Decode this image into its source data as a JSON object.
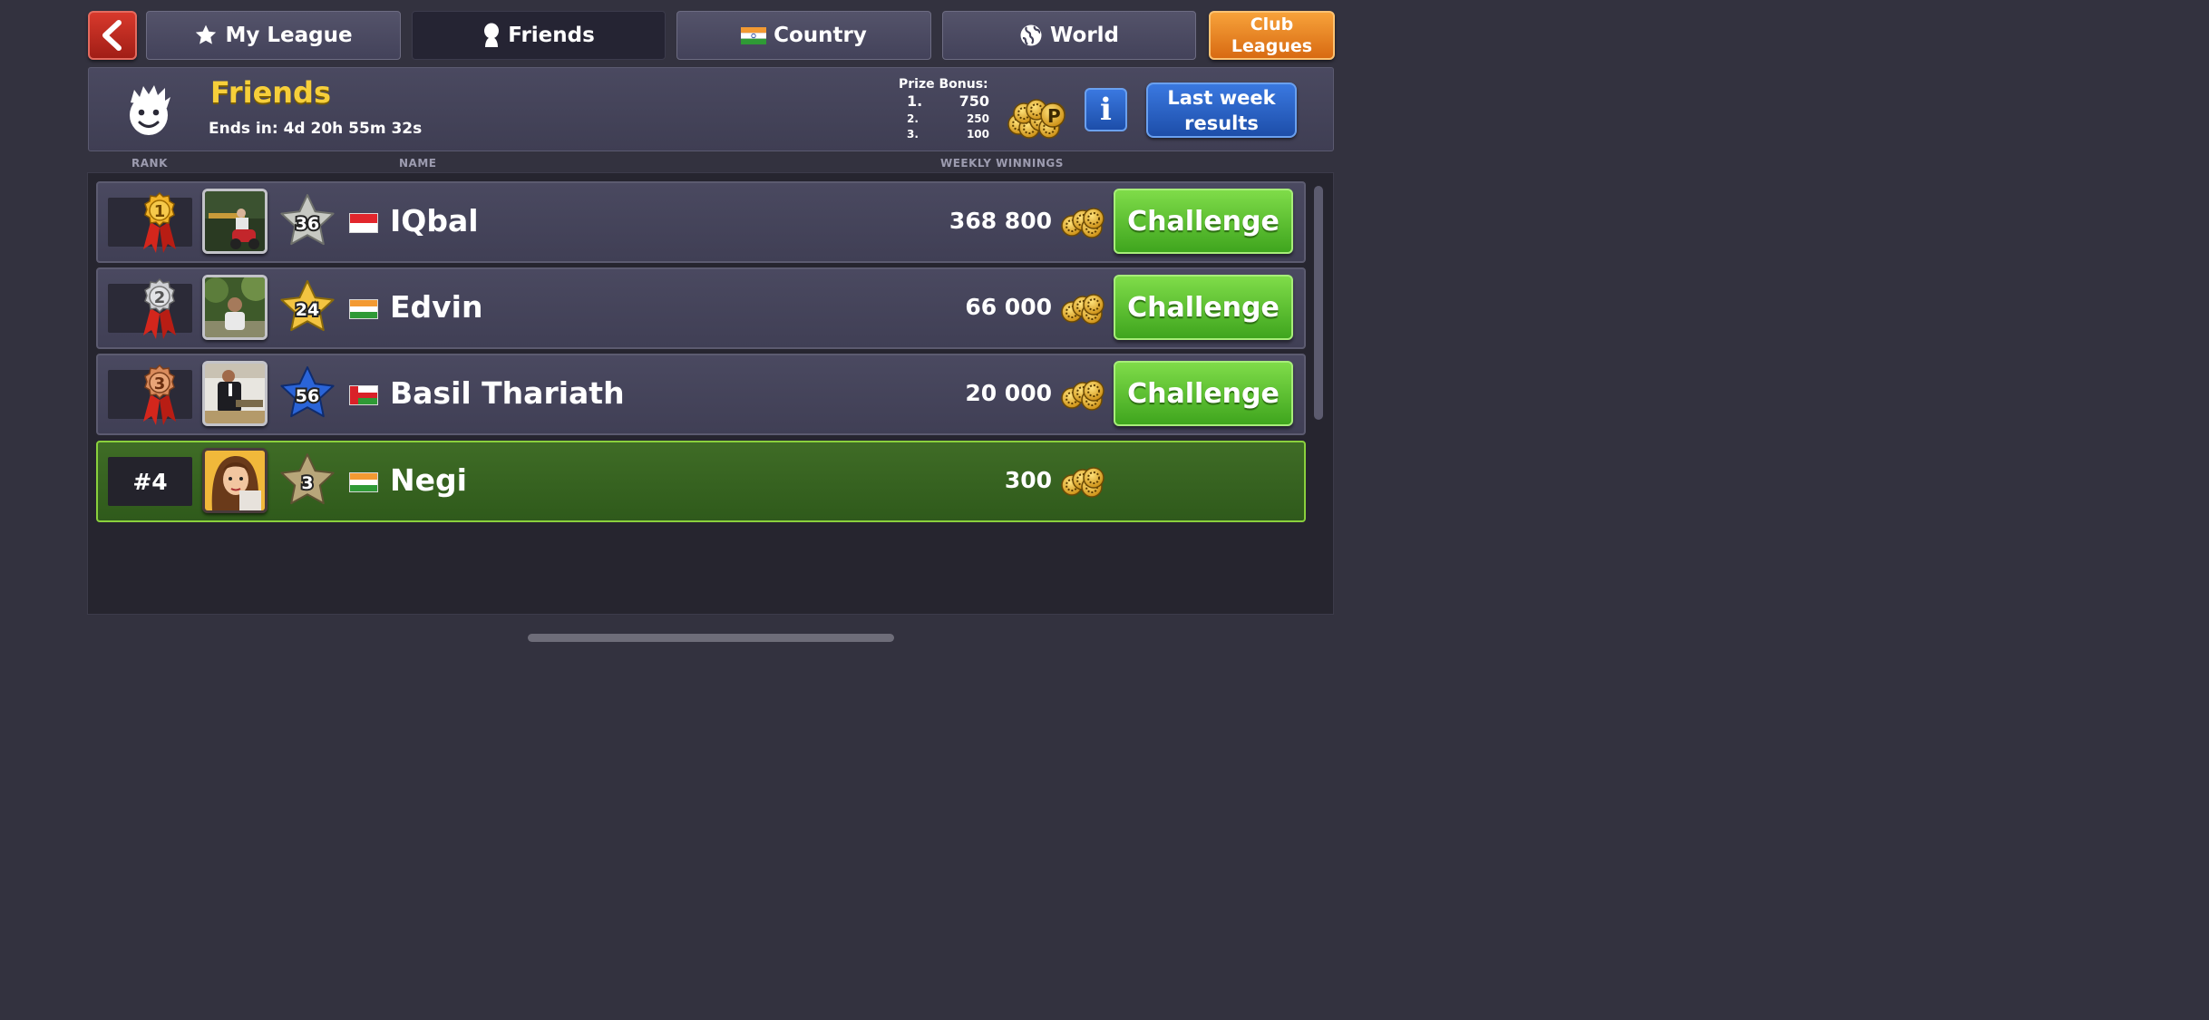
{
  "tabs": {
    "my_league": "My League",
    "friends": "Friends",
    "country": "Country",
    "world": "World",
    "club_leagues_line1": "Club",
    "club_leagues_line2": "Leagues"
  },
  "header": {
    "title": "Friends",
    "ends_in": "Ends in: 4d 20h 55m 32s",
    "prize_bonus_label": "Prize Bonus:",
    "prizes": [
      {
        "rank": "1.",
        "amount": "750"
      },
      {
        "rank": "2.",
        "amount": "250"
      },
      {
        "rank": "3.",
        "amount": "100"
      }
    ],
    "info_label": "i",
    "last_week_line1": "Last week",
    "last_week_line2": "results"
  },
  "columns": {
    "rank": "RANK",
    "name": "NAME",
    "winnings": "WEEKLY WINNINGS"
  },
  "rows": [
    {
      "rank": "1",
      "level": "36",
      "name": "IQbal",
      "winnings": "368 800",
      "action": "Challenge",
      "flag": "indonesia",
      "star_color": "#c7c9c3",
      "medal": "gold"
    },
    {
      "rank": "2",
      "level": "24",
      "name": "Edvin",
      "winnings": "66 000",
      "action": "Challenge",
      "flag": "india",
      "star_color": "#f3c441",
      "medal": "silver"
    },
    {
      "rank": "3",
      "level": "56",
      "name": "Basil Thariath",
      "winnings": "20 000",
      "action": "Challenge",
      "flag": "oman",
      "star_color": "#2a64d8",
      "medal": "bronze"
    },
    {
      "rank": "#4",
      "level": "3",
      "name": "Negi",
      "winnings": "300",
      "flag": "india",
      "star_color": "#b8a67a"
    }
  ]
}
